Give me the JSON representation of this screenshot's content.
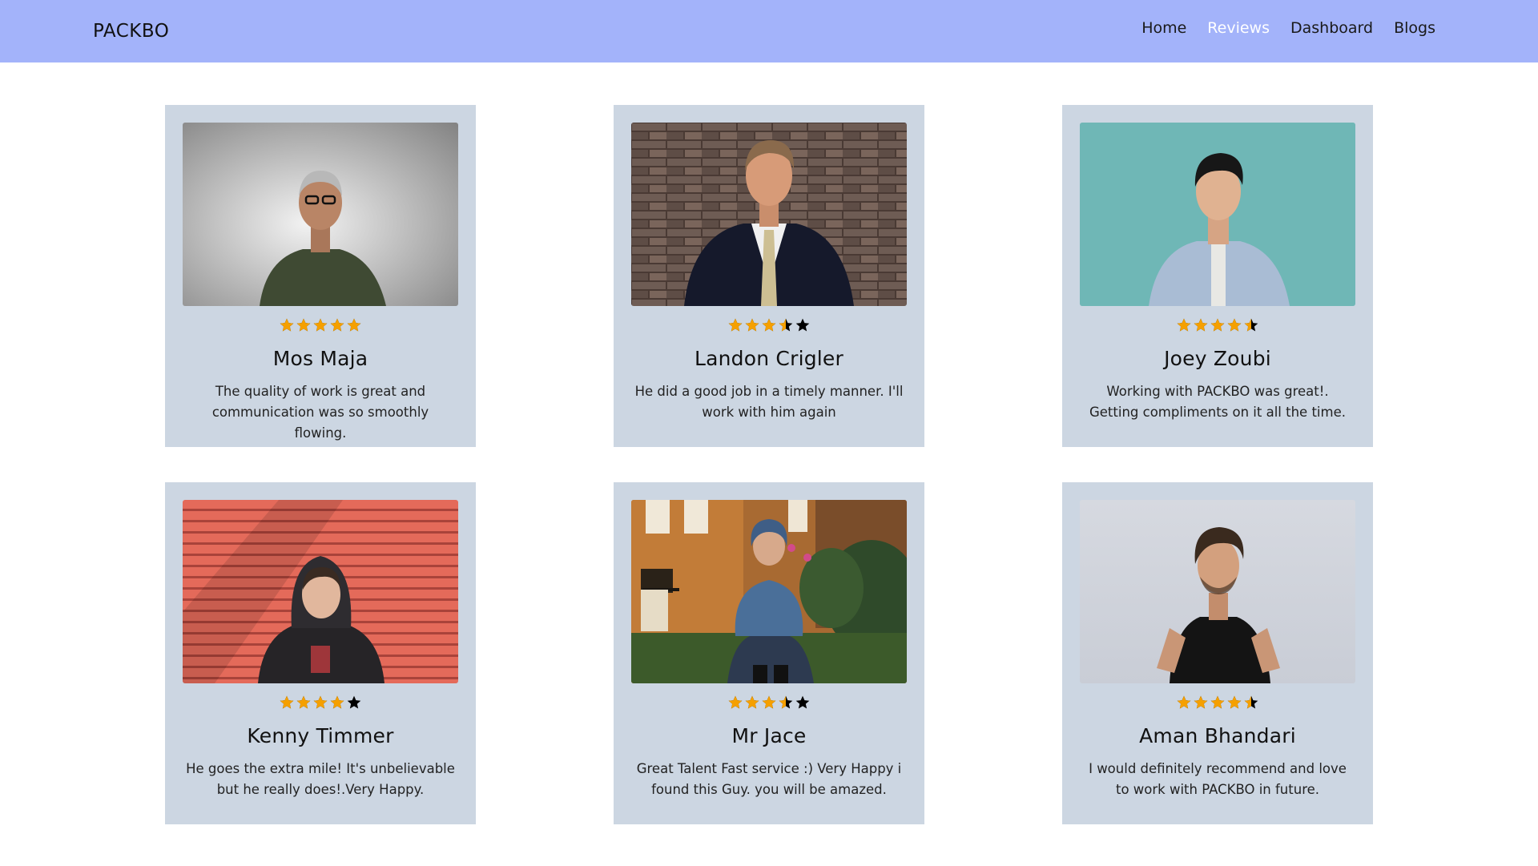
{
  "brand": "PACKBO",
  "nav": [
    {
      "label": "Home",
      "active": false
    },
    {
      "label": "Reviews",
      "active": true
    },
    {
      "label": "Dashboard",
      "active": false
    },
    {
      "label": "Blogs",
      "active": false
    }
  ],
  "colors": {
    "navbar": "#a3b3fa",
    "card": "#ccd6e2",
    "star_filled": "#f5a000",
    "star_empty": "#000000",
    "nav_active": "#ffffff"
  },
  "reviews": [
    {
      "name": "Mos Maja",
      "rating": 5,
      "comment": "The quality of work is great and communication was so smoothly flowing."
    },
    {
      "name": "Landon Crigler",
      "rating": 3.5,
      "comment": "He did a good job in a timely manner. I'll work with him again"
    },
    {
      "name": "Joey Zoubi",
      "rating": 4.5,
      "comment": "Working with PACKBO was great!. Getting compliments on it all the time."
    },
    {
      "name": "Kenny Timmer",
      "rating": 4,
      "comment": "He goes the extra mile! It's unbelievable but he really does!.Very Happy."
    },
    {
      "name": "Mr Jace",
      "rating": 3.5,
      "comment": "Great Talent Fast service :) Very Happy i found this Guy. you will be amazed."
    },
    {
      "name": "Aman Bhandari",
      "rating": 4.5,
      "comment": "I would definitely recommend and love to work with PACKBO in future."
    }
  ]
}
